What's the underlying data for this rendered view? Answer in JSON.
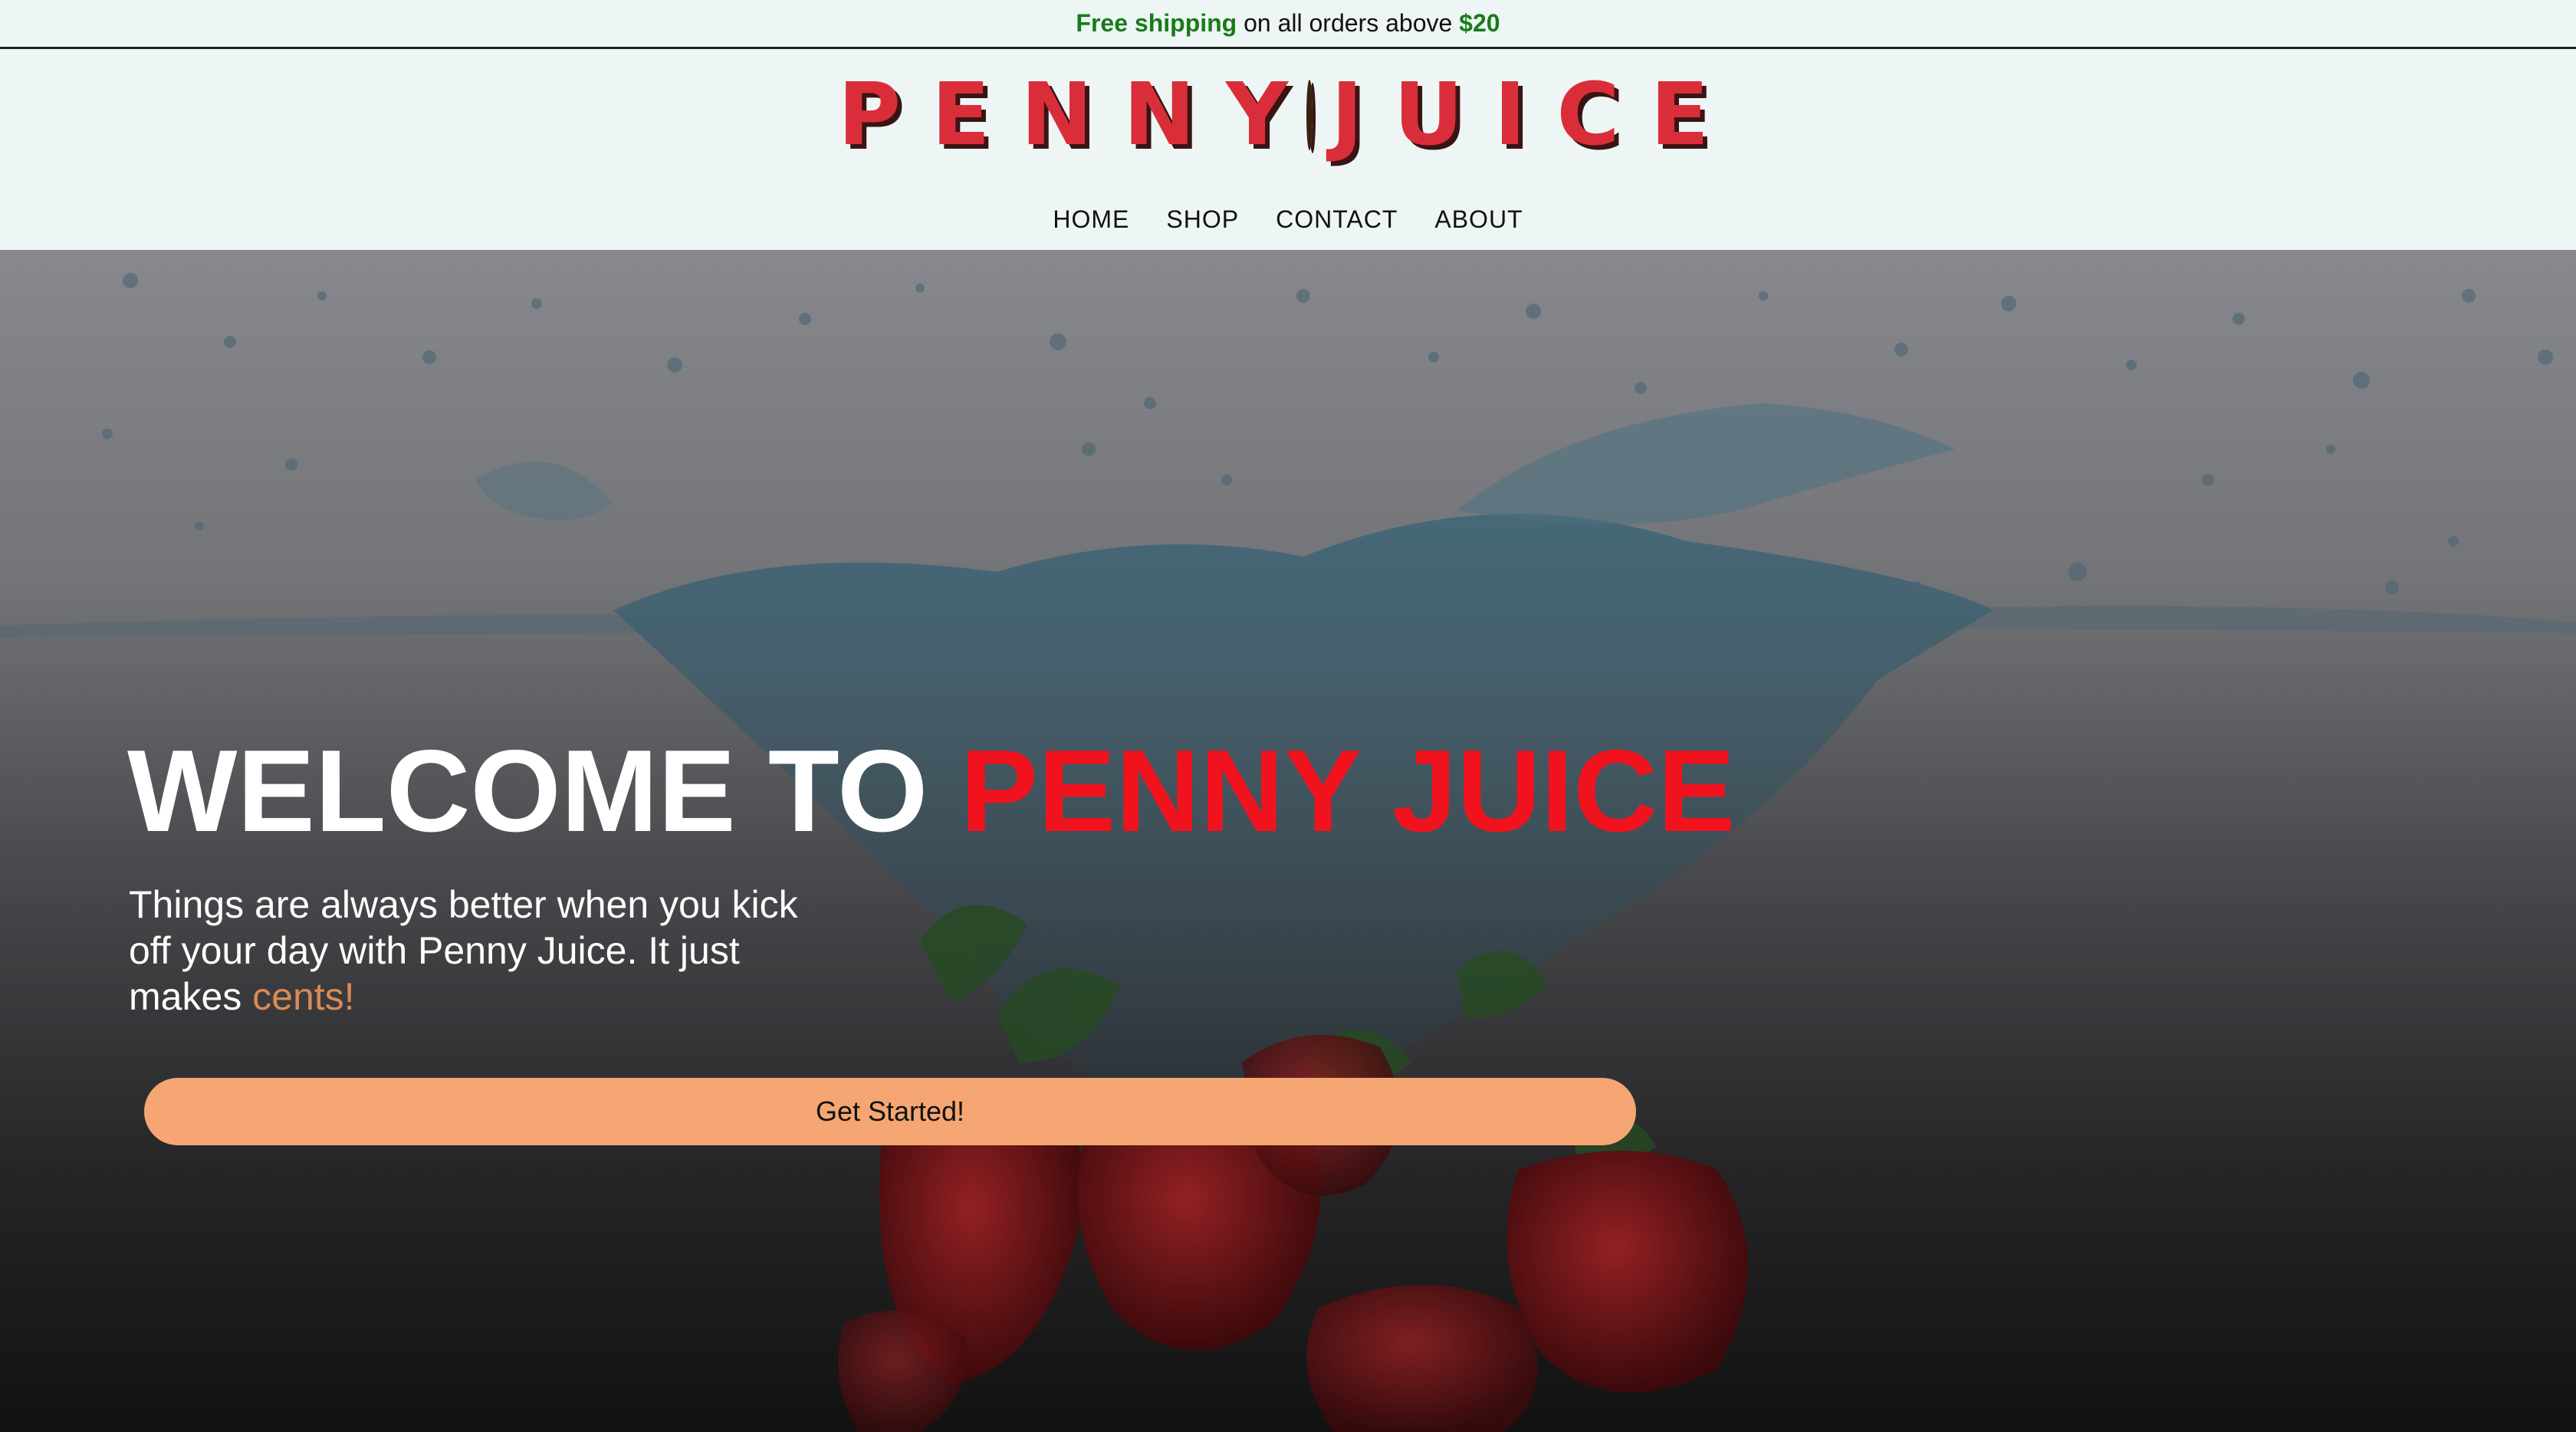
{
  "promo": {
    "highlight": "Free shipping",
    "text": "on all orders above",
    "amount": "$20"
  },
  "logo": {
    "left_word": "PENNY",
    "right_word": "JUICE",
    "icon": "penny-coin-icon"
  },
  "nav": {
    "items": [
      {
        "label": "HOME"
      },
      {
        "label": "SHOP"
      },
      {
        "label": "CONTACT"
      },
      {
        "label": "ABOUT"
      }
    ]
  },
  "hero": {
    "title_prefix": "WELCOME TO",
    "title_brand": "PENNY JUICE",
    "subtitle": "Things are always better when you kick off your day with Penny Juice. It just makes",
    "subtitle_accent": "cents!",
    "cta_label": "Get Started!",
    "background": "strawberries-water-splash-image"
  },
  "colors": {
    "promo_green": "#1a7a1a",
    "brand_red": "#f0131e",
    "cta_peach": "#f5a673",
    "accent_copper": "#d98a55",
    "header_bg": "#edf6f4"
  }
}
